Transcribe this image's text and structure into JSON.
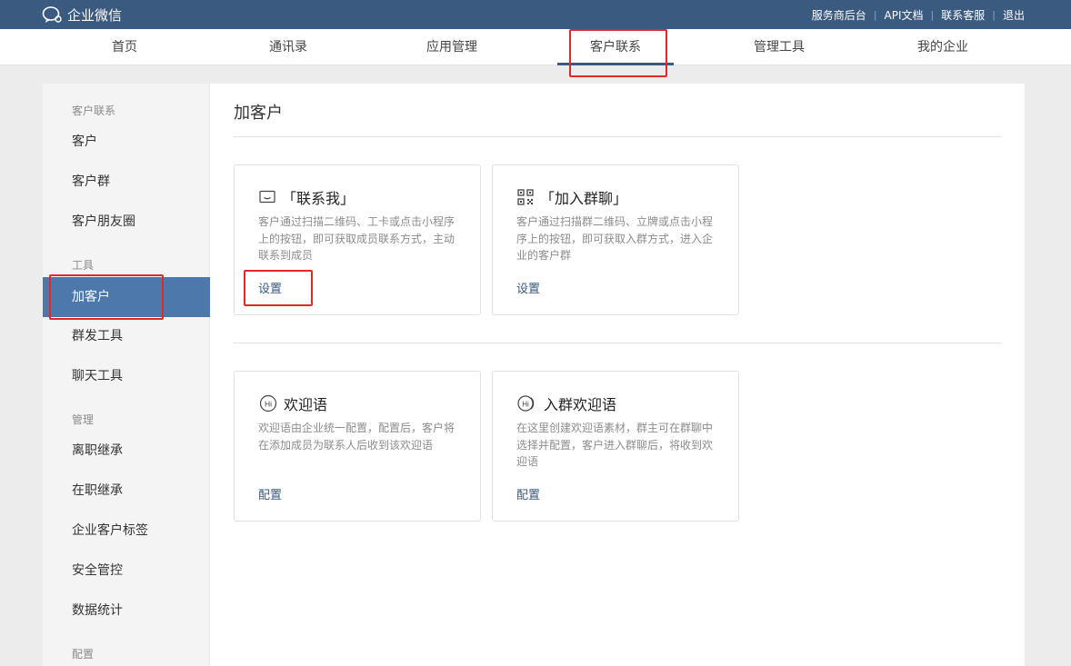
{
  "app": {
    "title": "企业微信"
  },
  "toplinks": [
    "服务商后台",
    "API文档",
    "联系客服",
    "退出"
  ],
  "nav": {
    "tabs": [
      {
        "label": "首页"
      },
      {
        "label": "通讯录"
      },
      {
        "label": "应用管理"
      },
      {
        "label": "客户联系",
        "active": true
      },
      {
        "label": "管理工具"
      },
      {
        "label": "我的企业"
      }
    ]
  },
  "sidebar": {
    "sections": [
      "客户联系",
      "工具",
      "管理",
      "配置"
    ],
    "items": [
      {
        "label": "客户"
      },
      {
        "label": "客户群"
      },
      {
        "label": "客户朋友圈"
      },
      {
        "label": "加客户",
        "active": true
      },
      {
        "label": "群发工具"
      },
      {
        "label": "聊天工具"
      },
      {
        "label": "离职继承"
      },
      {
        "label": "在职继承"
      },
      {
        "label": "企业客户标签"
      },
      {
        "label": "安全管控"
      },
      {
        "label": "数据统计"
      }
    ]
  },
  "main": {
    "title": "加客户",
    "cards": [
      {
        "icon": "message-icon",
        "title": "「联系我」",
        "desc": "客户通过扫描二维码、工卡或点击小程序上的按钮，即可获取成员联系方式，主动联系到成员",
        "link": "设置"
      },
      {
        "icon": "qr-code-icon",
        "title": "「加入群聊」",
        "desc": "客户通过扫描群二维码、立牌或点击小程序上的按钮，即可获取入群方式，进入企业的客户群",
        "link": "设置"
      },
      {
        "icon": "hi-icon",
        "title": "欢迎语",
        "desc": "欢迎语由企业统一配置，配置后，客户将在添加成员为联系人后收到该欢迎语",
        "link": "配置"
      },
      {
        "icon": "group-hi-icon",
        "title": "入群欢迎语",
        "desc": "在这里创建欢迎语素材，群主可在群聊中选择并配置，客户进入群聊后，将收到欢迎语",
        "link": "配置"
      }
    ]
  },
  "colors": {
    "header": "#3a5a80",
    "active_item": "#4d78ac",
    "highlight_box": "#e0292a",
    "link": "#3a5a80"
  }
}
